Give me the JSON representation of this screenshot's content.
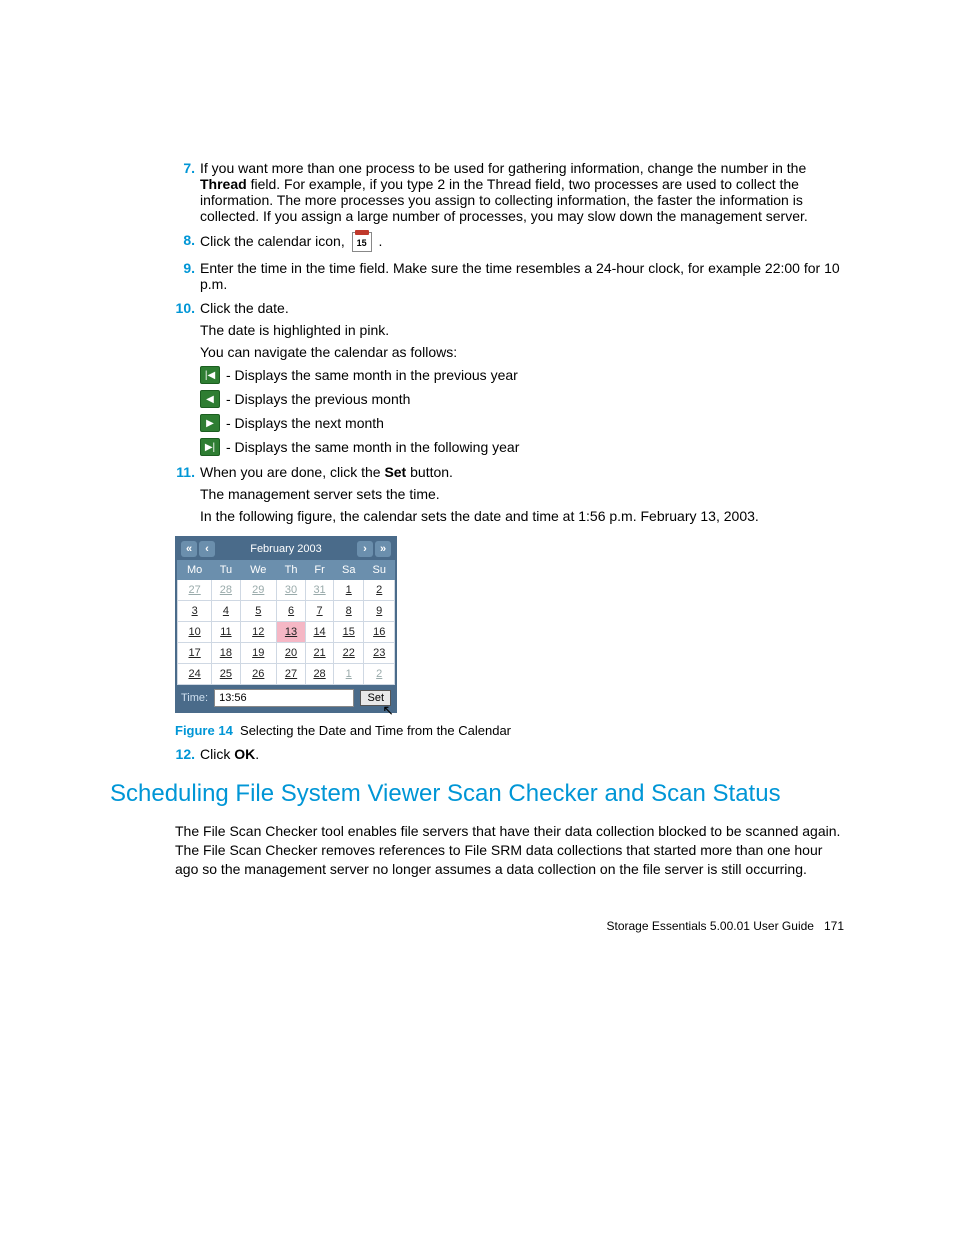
{
  "steps": {
    "s7": {
      "num": "7.",
      "text_a": "If you want more than one process to be used for gathering information, change the number in the ",
      "bold": "Thread",
      "text_b": " field. For example, if you type 2 in the Thread field, two processes are used to collect the information. The more processes you assign to collecting information, the faster the information is collected. If you assign a large number of processes, you may slow down the management server."
    },
    "s8": {
      "num": "8.",
      "text_a": "Click the calendar icon, ",
      "icon_text": "15",
      "text_b": "."
    },
    "s9": {
      "num": "9.",
      "text": "Enter the time in the time field. Make sure the time resembles a 24-hour clock, for example 22:00 for 10 p.m."
    },
    "s10": {
      "num": "10.",
      "text": "Click the date.",
      "sub1": "The date is highlighted in pink.",
      "sub2": "You can navigate the calendar as follows:",
      "nav": [
        {
          "icon": "|◀",
          "text": "- Displays the same month in the previous year"
        },
        {
          "icon": "◀",
          "text": "- Displays the previous month"
        },
        {
          "icon": "▶",
          "text": "- Displays the next month"
        },
        {
          "icon": "▶|",
          "text": "- Displays the same month in the following year"
        }
      ]
    },
    "s11": {
      "num": "11.",
      "text_a": "When you are done, click the ",
      "bold": "Set",
      "text_b": " button.",
      "sub1": "The management server sets the time.",
      "sub2": "In the following figure, the calendar sets the date and time at 1:56 p.m. February 13, 2003."
    },
    "s12": {
      "num": "12.",
      "text_a": "Click ",
      "bold": "OK",
      "text_b": "."
    }
  },
  "calendar": {
    "nav_prev_year": "«",
    "nav_prev_month": "‹",
    "title": "February 2003",
    "nav_next_month": "›",
    "nav_next_year": "»",
    "dow": [
      "Mo",
      "Tu",
      "We",
      "Th",
      "Fr",
      "Sa",
      "Su"
    ],
    "rows": [
      [
        {
          "v": "27",
          "g": true
        },
        {
          "v": "28",
          "g": true
        },
        {
          "v": "29",
          "g": true
        },
        {
          "v": "30",
          "g": true
        },
        {
          "v": "31",
          "g": true
        },
        {
          "v": "1"
        },
        {
          "v": "2"
        }
      ],
      [
        {
          "v": "3"
        },
        {
          "v": "4"
        },
        {
          "v": "5"
        },
        {
          "v": "6"
        },
        {
          "v": "7"
        },
        {
          "v": "8"
        },
        {
          "v": "9"
        }
      ],
      [
        {
          "v": "10"
        },
        {
          "v": "11"
        },
        {
          "v": "12"
        },
        {
          "v": "13",
          "sel": true
        },
        {
          "v": "14"
        },
        {
          "v": "15"
        },
        {
          "v": "16"
        }
      ],
      [
        {
          "v": "17"
        },
        {
          "v": "18"
        },
        {
          "v": "19"
        },
        {
          "v": "20"
        },
        {
          "v": "21"
        },
        {
          "v": "22"
        },
        {
          "v": "23"
        }
      ],
      [
        {
          "v": "24"
        },
        {
          "v": "25"
        },
        {
          "v": "26"
        },
        {
          "v": "27"
        },
        {
          "v": "28"
        },
        {
          "v": "1",
          "g": true
        },
        {
          "v": "2",
          "g": true
        }
      ]
    ],
    "time_label": "Time:",
    "time_value": "13:56",
    "set_label": "Set"
  },
  "figure": {
    "num": "Figure 14",
    "caption": "Selecting the Date and Time from the Calendar"
  },
  "section_title": "Scheduling File System Viewer Scan Checker and Scan Status",
  "section_body": "The File Scan Checker tool enables file servers that have their data collection blocked to be scanned again. The File Scan Checker removes references to File SRM data collections that started more than one hour ago so the management server no longer assumes a data collection on the file server is still occurring.",
  "footer": {
    "title": "Storage Essentials 5.00.01 User Guide",
    "page": "171"
  }
}
